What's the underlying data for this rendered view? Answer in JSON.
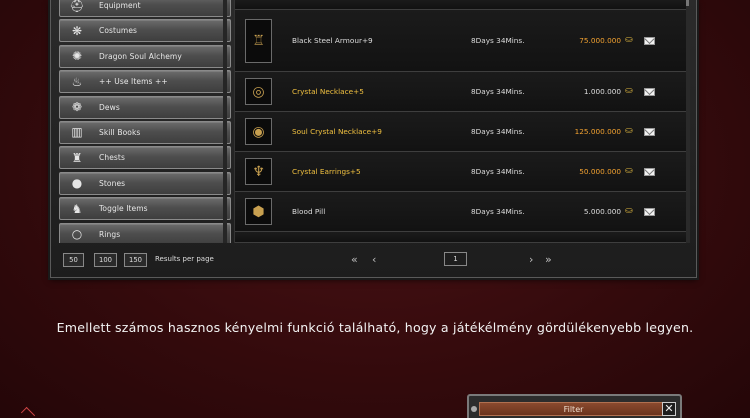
{
  "categories": [
    {
      "label": "Equipment",
      "icon": "helmet-icon",
      "glyph": "⛑"
    },
    {
      "label": "Costumes",
      "icon": "costume-icon",
      "glyph": "❋"
    },
    {
      "label": "Dragon Soul Alchemy",
      "icon": "dragon-soul-icon",
      "glyph": "✺"
    },
    {
      "label": "++ Use Items ++",
      "icon": "potion-icon",
      "glyph": "♨"
    },
    {
      "label": "Dews",
      "icon": "dew-icon",
      "glyph": "❁"
    },
    {
      "label": "Skill Books",
      "icon": "book-icon",
      "glyph": "▥"
    },
    {
      "label": "Chests",
      "icon": "sack-icon",
      "glyph": "♜"
    },
    {
      "label": "Stones",
      "icon": "stone-icon",
      "glyph": "●"
    },
    {
      "label": "Toggle Items",
      "icon": "horse-icon",
      "glyph": "♞"
    },
    {
      "label": "Rings",
      "icon": "ring-icon",
      "glyph": "○"
    }
  ],
  "items": [
    {
      "name": "Black Steel Armour+9",
      "name_gold": false,
      "time": "8Days 34Mins.",
      "price": "75.000.000",
      "price_gold": true,
      "icon": "armour-icon",
      "glyph": "♖"
    },
    {
      "name": "Crystal Necklace+5",
      "name_gold": true,
      "time": "8Days 34Mins.",
      "price": "1.000.000",
      "price_gold": false,
      "icon": "necklace-icon",
      "glyph": "◎"
    },
    {
      "name": "Soul Crystal Necklace+9",
      "name_gold": true,
      "time": "8Days 34Mins.",
      "price": "125.000.000",
      "price_gold": true,
      "icon": "soul-necklace-icon",
      "glyph": "◉"
    },
    {
      "name": "Crystal Earrings+5",
      "name_gold": true,
      "time": "8Days 34Mins.",
      "price": "50.000.000",
      "price_gold": true,
      "icon": "earrings-icon",
      "glyph": "♆"
    },
    {
      "name": "Blood Pill",
      "name_gold": false,
      "time": "8Days 34Mins.",
      "price": "5.000.000",
      "price_gold": false,
      "icon": "pill-icon",
      "glyph": "⬢"
    }
  ],
  "pagination": {
    "rpp_options": [
      "50",
      "100",
      "150"
    ],
    "rpp_label": "Results per page",
    "first": "«",
    "prev": "‹",
    "next": "›",
    "last": "»",
    "page": "1"
  },
  "caption": "Emellett számos hasznos kényelmi funkció található, hogy a játékélmény gördülékenyebb legyen.",
  "filter": {
    "label": "Filter",
    "close": "✕"
  },
  "colors": {
    "gold_text": "#f0c040",
    "price_gold": "#f0a030",
    "background": "#3a0b0d"
  }
}
